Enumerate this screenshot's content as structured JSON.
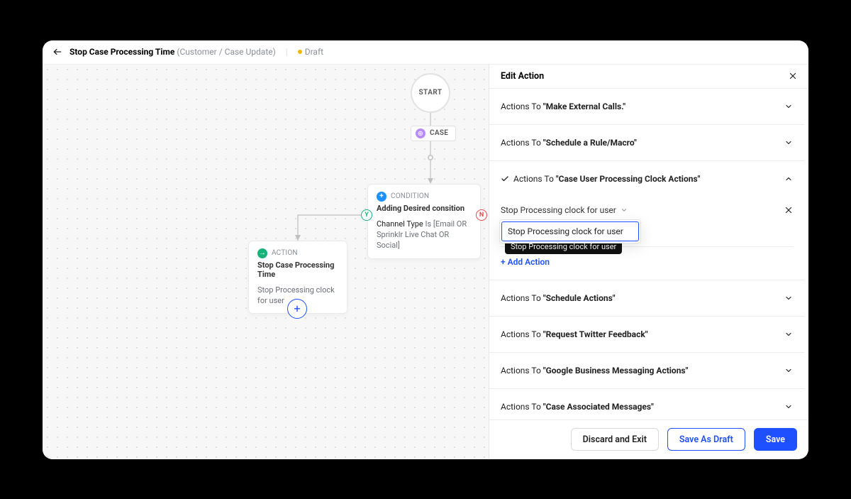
{
  "header": {
    "title": "Stop Case Processing Time",
    "subtitle": "(Customer / Case Update)",
    "status_label": "Draft"
  },
  "canvas": {
    "start_label": "START",
    "entity_pill": "CASE",
    "condition": {
      "type_label": "CONDITION",
      "title": "Adding Desired consition",
      "rule_prefix": "Channel Type",
      "rule_verb": "Is",
      "rule_value": "[Email OR Sprinklr Live Chat OR Social]"
    },
    "action": {
      "type_label": "ACTION",
      "title": "Stop Case Processing Time",
      "sub": "Stop Processing clock for user"
    },
    "yes_badge": "Y",
    "no_badge": "N"
  },
  "panel": {
    "title": "Edit Action",
    "actions_prefix": "Actions To ",
    "sections": [
      {
        "name": "Make External Calls."
      },
      {
        "name": "Schedule a Rule/Macro"
      },
      {
        "name": "Case User Processing Clock Actions",
        "expanded": true,
        "checked": true
      },
      {
        "name": "Schedule Actions"
      },
      {
        "name": "Request Twitter Feedback"
      },
      {
        "name": "Google Business Messaging Actions"
      },
      {
        "name": "Case Associated Messages"
      }
    ],
    "dropdown": {
      "selected": "Stop Processing clock for user",
      "option": "Stop Processing clock for user",
      "tooltip": "Stop Processing clock for user"
    },
    "add_action_label": "+ Add Action"
  },
  "footer": {
    "discard": "Discard and Exit",
    "save_draft": "Save As Draft",
    "save": "Save"
  }
}
